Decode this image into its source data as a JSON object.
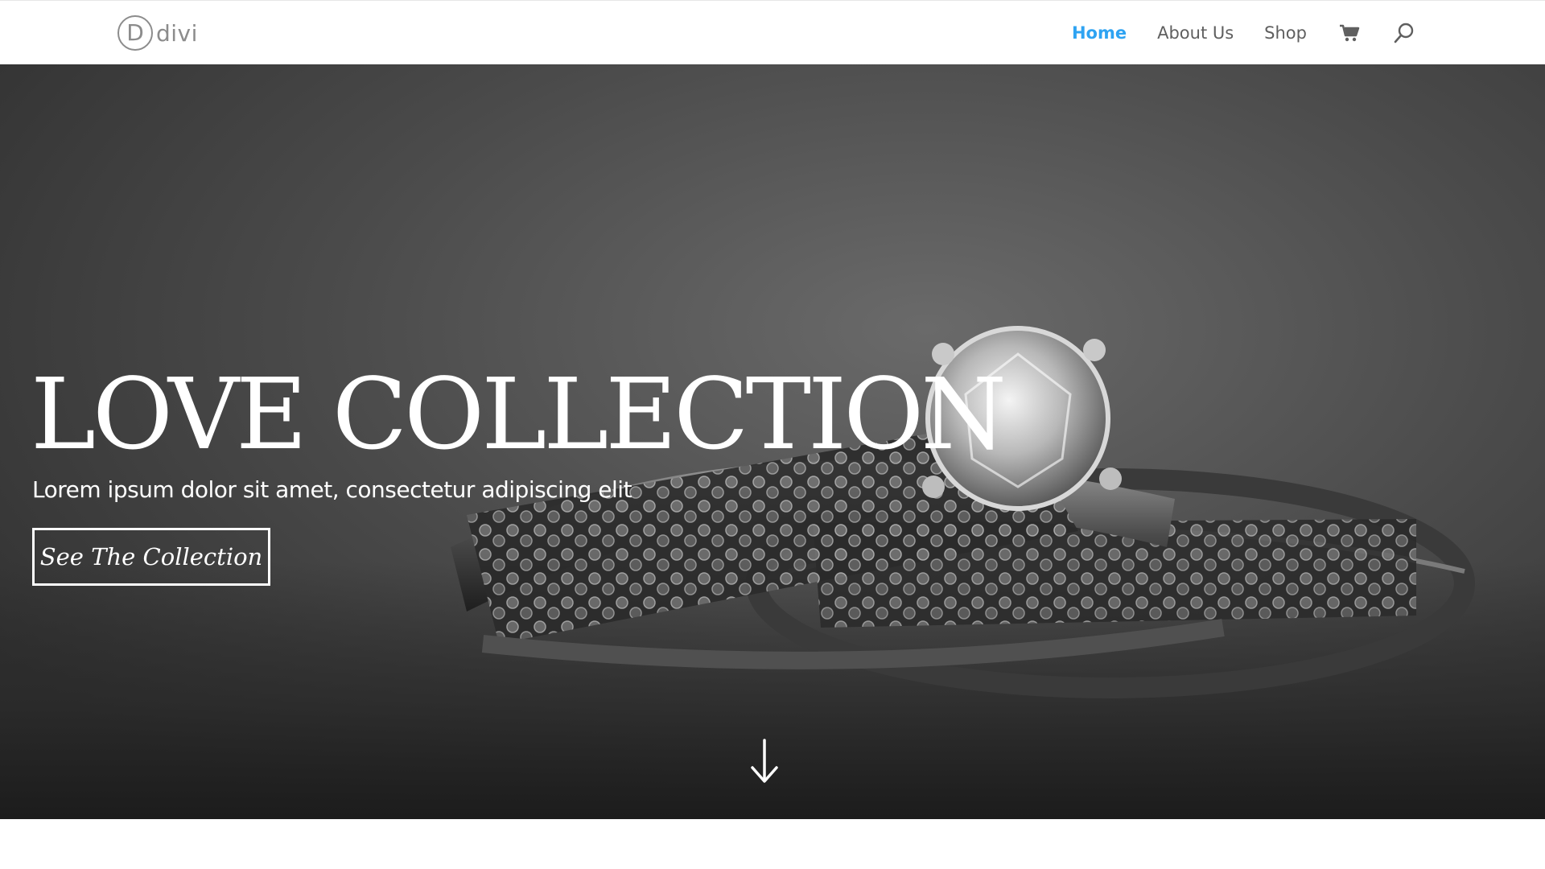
{
  "header": {
    "logo": {
      "mark": "D",
      "text": "divi"
    },
    "nav": {
      "items": [
        {
          "label": "Home",
          "active": true
        },
        {
          "label": "About Us",
          "active": false
        },
        {
          "label": "Shop",
          "active": false
        }
      ],
      "icons": [
        "cart-icon",
        "search-icon"
      ]
    }
  },
  "hero": {
    "title": "LOVE COLLECTION",
    "subtitle": "Lorem ipsum dolor sit amet, consectetur adipiscing elit",
    "button_label": "See The Collection",
    "scroll_icon": "arrow-down-icon"
  },
  "colors": {
    "accent": "#2ea3f2",
    "nav_text": "#5f5f5f",
    "hero_text": "#ffffff"
  }
}
